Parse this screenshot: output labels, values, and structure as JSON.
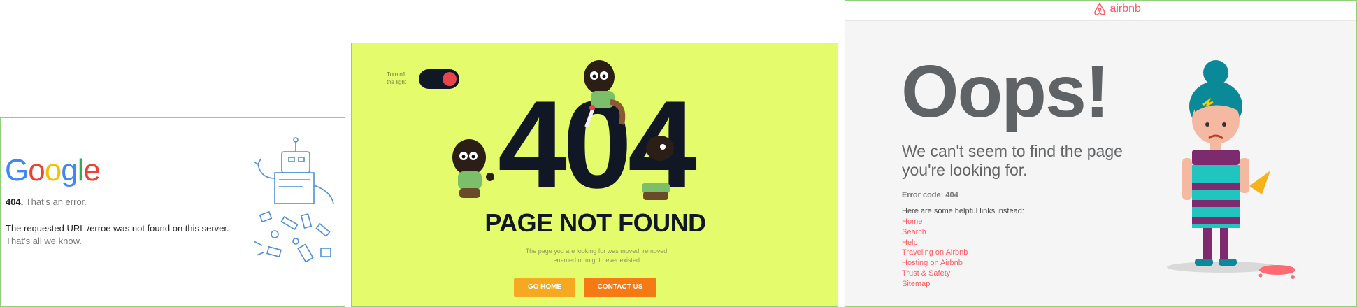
{
  "google": {
    "logo_letters": [
      {
        "ch": "G",
        "color": "#4285F4"
      },
      {
        "ch": "o",
        "color": "#EA4335"
      },
      {
        "ch": "o",
        "color": "#FBBC05"
      },
      {
        "ch": "g",
        "color": "#4285F4"
      },
      {
        "ch": "l",
        "color": "#34A853"
      },
      {
        "ch": "e",
        "color": "#EA4335"
      }
    ],
    "code": "404.",
    "error_short": "That’s an error.",
    "message": "The requested URL /erroe was not found on this server.",
    "known": "That’s all we know."
  },
  "notfound": {
    "toggle_label_line1": "Turn off",
    "toggle_label_line2": "the light",
    "big_code": "404",
    "title": "PAGE NOT FOUND",
    "subtitle_line1": "The page you are looking for was moved, removed",
    "subtitle_line2": "renamed or might never existed.",
    "home_button": "GO HOME",
    "contact_button": "CONTACT US",
    "colors": {
      "background": "#e4fb6b",
      "text": "#121726",
      "home": "#f6a920",
      "contact": "#f67a13"
    }
  },
  "airbnb": {
    "brand": "airbnb",
    "heading": "Oops!",
    "subtitle": "We can't seem to find the page you're looking for.",
    "error_code": "Error code: 404",
    "helpful": "Here are some helpful links instead:",
    "links": [
      "Home",
      "Search",
      "Help",
      "Traveling on Airbnb",
      "Hosting on Airbnb",
      "Trust & Safety",
      "Sitemap"
    ],
    "colors": {
      "brand": "#ff5a5f",
      "heading": "#5f6366"
    }
  }
}
